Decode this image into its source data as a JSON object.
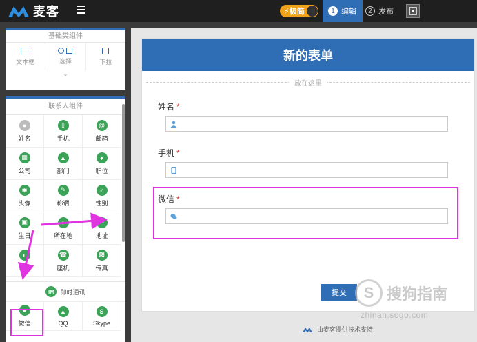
{
  "topbar": {
    "brand": "麦客",
    "mode_label": "⚡极简",
    "steps": [
      {
        "num": "1",
        "label": "编辑",
        "active": true
      },
      {
        "num": "2",
        "label": "发布",
        "active": false
      }
    ]
  },
  "basic_panel": {
    "title": "基础类组件",
    "items": [
      "文本框",
      "选择",
      "下拉"
    ]
  },
  "contact_panel": {
    "title": "联系人组件",
    "items": [
      "姓名",
      "手机",
      "邮箱",
      "公司",
      "部门",
      "职位",
      "头像",
      "称谓",
      "性别",
      "生日",
      "所在地",
      "地址",
      "网址",
      "座机",
      "传真"
    ],
    "im_title": "即时通讯",
    "im_badge": "IM",
    "im_items": [
      "微信",
      "QQ",
      "Skype"
    ]
  },
  "form": {
    "title": "新的表单",
    "drop_hint": "放在这里",
    "fields": [
      {
        "label": "姓名",
        "required": "*"
      },
      {
        "label": "手机",
        "required": "*"
      },
      {
        "label": "微信",
        "required": "*"
      }
    ],
    "submit_label": "提交",
    "powered_by": "由麦客提供技术支持"
  },
  "watermark": {
    "text": "搜狗指南",
    "url": "zhinan.sogo.com"
  },
  "colors": {
    "accent": "#2f6db5",
    "icon_green": "#3aa357",
    "highlight": "#e134e1",
    "mode_orange": "#f0a21b"
  }
}
